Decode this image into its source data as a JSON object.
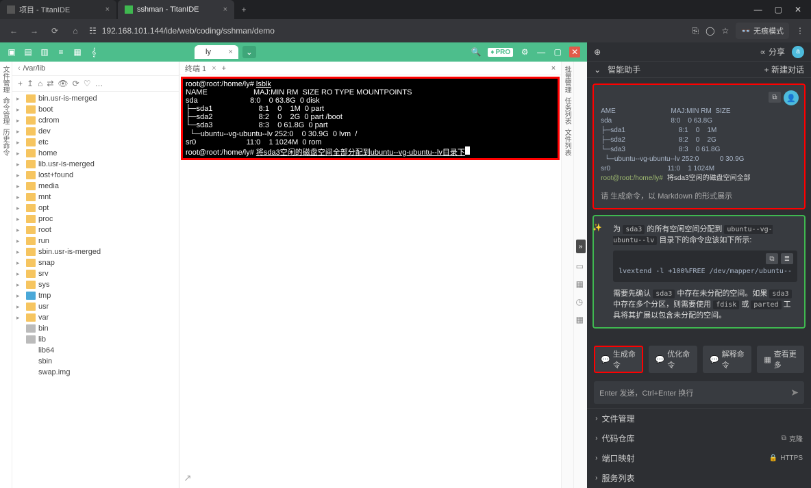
{
  "browser": {
    "tabs": [
      {
        "title": "项目 - TitanIDE",
        "active": false
      },
      {
        "title": "sshman - TitanIDE",
        "active": true
      }
    ],
    "url": "192.168.101.144/ide/web/coding/sshman/demo",
    "incognito_label": "无痕模式"
  },
  "ide": {
    "file_tab": "ly",
    "pro_label": "PRO",
    "breadcrumb_parts": [
      "/var/lib"
    ],
    "terminal_tab": "终端 1",
    "tree": [
      {
        "name": "bin.usr-is-merged",
        "type": "folder"
      },
      {
        "name": "boot",
        "type": "folder"
      },
      {
        "name": "cdrom",
        "type": "folder"
      },
      {
        "name": "dev",
        "type": "folder"
      },
      {
        "name": "etc",
        "type": "folder"
      },
      {
        "name": "home",
        "type": "folder"
      },
      {
        "name": "lib.usr-is-merged",
        "type": "folder"
      },
      {
        "name": "lost+found",
        "type": "folder"
      },
      {
        "name": "media",
        "type": "folder"
      },
      {
        "name": "mnt",
        "type": "folder"
      },
      {
        "name": "opt",
        "type": "folder"
      },
      {
        "name": "proc",
        "type": "folder-plain"
      },
      {
        "name": "root",
        "type": "folder"
      },
      {
        "name": "run",
        "type": "folder"
      },
      {
        "name": "sbin.usr-is-merged",
        "type": "folder"
      },
      {
        "name": "snap",
        "type": "folder"
      },
      {
        "name": "srv",
        "type": "folder"
      },
      {
        "name": "sys",
        "type": "folder-plain"
      },
      {
        "name": "tmp",
        "type": "folder-blue"
      },
      {
        "name": "usr",
        "type": "folder"
      },
      {
        "name": "var",
        "type": "folder"
      },
      {
        "name": "bin",
        "type": "file"
      },
      {
        "name": "lib",
        "type": "file"
      },
      {
        "name": "lib64",
        "type": "file-plain"
      },
      {
        "name": "sbin",
        "type": "file-plain"
      },
      {
        "name": "swap.img",
        "type": "file-plain"
      }
    ],
    "terminal": {
      "prompt1": "root@root:/home/ly# ",
      "cmd1": "lsblk",
      "header": "NAME                      MAJ:MIN RM  SIZE RO TYPE MOUNTPOINTS",
      "rows": [
        "sda                         8:0    0 63.8G  0 disk",
        "├─sda1                      8:1    0    1M  0 part",
        "├─sda2                      8:2    0    2G  0 part /boot",
        "└─sda3                      8:3    0 61.8G  0 part",
        "  └─ubuntu--vg-ubuntu--lv 252:0    0 30.9G  0 lvm  /",
        "sr0                        11:0    1 1024M  0 rom"
      ],
      "prompt2": "root@root:/home/ly# ",
      "cmd2": "将sda3空闲的磁盘空间全部分配到ubuntu--vg-ubuntu--lv目录下"
    },
    "vleft_labels": [
      "文件管理",
      "命令管理",
      "历史命令"
    ],
    "vright_labels": [
      "批量管理",
      "任务列表",
      "文件列表"
    ]
  },
  "assistant": {
    "header_icon": "⊕",
    "share_label": "分享",
    "avatar_letter": "a",
    "sub_title": "智能助手",
    "new_chat": "新建对话",
    "bubble1": {
      "header": "AME                             MAJ:MIN RM  SIZE",
      "rows": [
        "sda                               8:0    0 63.8G",
        "├─sda1                            8:1    0    1M",
        "├─sda2                            8:2    0    2G",
        "└─sda3                            8:3    0 61.8G",
        "  └─ubuntu--vg-ubuntu--lv 252:0           0 30.9G",
        "sr0                              11:0    1 1024M"
      ],
      "prompt": "root@root:/home/ly#",
      "user_cmd": "将sda3空闲的磁盘空间全部",
      "desc": "请 生成命令，以 Markdown 的形式展示"
    },
    "bubble2": {
      "intro_pre": "为 ",
      "intro_code1": "sda3",
      "intro_mid": " 的所有空闲空间分配到 ",
      "intro_code2": "ubuntu--vg-ubuntu--lv",
      "intro_post": " 目录下的命令应该如下所示:",
      "code": "lvextend -l +100%FREE /dev/mapper/ubuntu--",
      "note_prefix": "需要先确认 ",
      "note_code1": "sda3",
      "note_mid1": " 中存在未分配的空间。如果 ",
      "note_code2": "sda3",
      "note_mid2": " 中存在多个分区，则需要使用 ",
      "note_code3": "fdisk",
      "note_or": " 或 ",
      "note_code4": "parted",
      "note_end": " 工具将其扩展以包含未分配的空间。"
    },
    "buttons": {
      "gen": "生成命令",
      "opt": "优化命令",
      "explain": "解释命令",
      "more": "查看更多"
    },
    "input_placeholder": "Enter 发送，Ctrl+Enter 换行",
    "accordions": [
      {
        "label": "文件管理",
        "right": ""
      },
      {
        "label": "代码仓库",
        "right": "克隆",
        "right_icon": "⧉"
      },
      {
        "label": "端口映射",
        "right": "HTTPS",
        "right_icon": "🔒"
      },
      {
        "label": "服务列表",
        "right": ""
      }
    ]
  },
  "watermark": ""
}
